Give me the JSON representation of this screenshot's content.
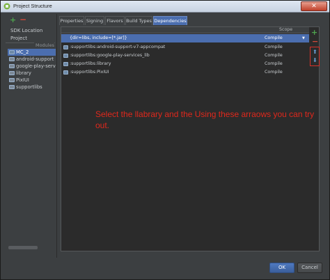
{
  "window": {
    "title": "Project Structure",
    "close_label": "✕"
  },
  "left": {
    "add_icon": "+",
    "remove_icon": "−",
    "items": [
      "SDK Location",
      "Project"
    ],
    "modules_label": "Modules",
    "modules": [
      "MC_2",
      "android-support",
      "google-play-serv",
      "library",
      "PixIUI",
      "supportlibs"
    ]
  },
  "tabs": [
    "Properties",
    "Signing",
    "Flavors",
    "Build Types",
    "Dependencies"
  ],
  "dependencies": {
    "scope_header": "Scope",
    "rows": [
      {
        "name": "{dir=libs, include=[*.jar]}",
        "scope": "Compile"
      },
      {
        "name": ":supportlibs:android-support-v7-appcompat",
        "scope": "Compile"
      },
      {
        "name": ":supportlibs:google-play-services_lib",
        "scope": "Compile"
      },
      {
        "name": ":supportlibs:library",
        "scope": "Compile"
      },
      {
        "name": ":supportlibs:PixIUI",
        "scope": "Compile"
      }
    ],
    "scope_arrow": "▼"
  },
  "tools": {
    "add": "+",
    "remove": "−",
    "up": "⬆",
    "down": "⬇"
  },
  "annotation": "Select the llabrary and the Using these arraows you can try out.",
  "footer": {
    "ok": "OK",
    "cancel": "Cancel"
  },
  "colors": {
    "selection": "#4b6eaf",
    "annotation": "#e0281c",
    "panel_bg": "#3c3f41"
  }
}
